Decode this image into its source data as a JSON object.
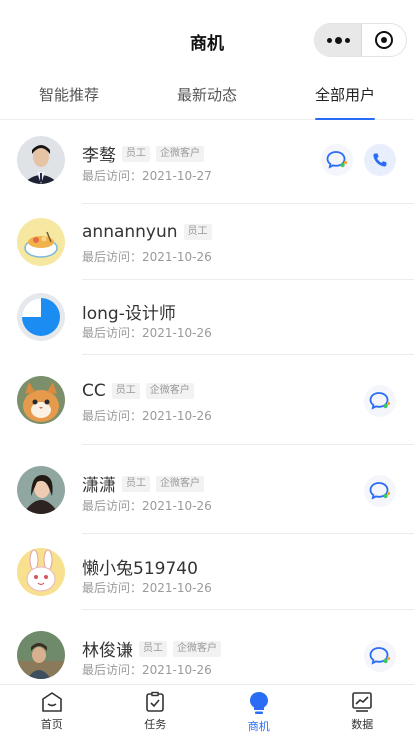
{
  "navbar": {
    "title": "商机"
  },
  "tabs": [
    {
      "label": "智能推荐",
      "active": false
    },
    {
      "label": "最新动态",
      "active": false
    },
    {
      "label": "全部用户",
      "active": true
    }
  ],
  "users": [
    {
      "name": "李骜",
      "tags": [
        "员工",
        "企微客户"
      ],
      "visit": "最后访问：2021-10-27",
      "avatar": "photo-man-suit",
      "chat": true,
      "phone": true
    },
    {
      "name": "annannyun",
      "tags": [
        "员工"
      ],
      "visit": "最后访问：2021-10-26",
      "avatar": "food-bowl",
      "chat": false,
      "phone": false
    },
    {
      "name": "long-设计师",
      "tags": [],
      "visit": "最后访问：2021-10-26",
      "avatar": "blue-pie",
      "chat": false,
      "phone": false
    },
    {
      "name": "CC",
      "tags": [
        "员工",
        "企微客户"
      ],
      "visit": "最后访问：2021-10-26",
      "avatar": "cat-photo",
      "chat": true,
      "phone": false
    },
    {
      "name": "潇潇",
      "tags": [
        "员工",
        "企微客户"
      ],
      "visit": "最后访问：2021-10-26",
      "avatar": "woman-photo",
      "chat": true,
      "phone": false
    },
    {
      "name": "懒小兔519740",
      "tags": [],
      "visit": "最后访问：2021-10-26",
      "avatar": "rabbit-cartoon",
      "chat": false,
      "phone": false
    },
    {
      "name": "林俊谦",
      "tags": [
        "员工",
        "企微客户"
      ],
      "visit": "最后访问：2021-10-26",
      "avatar": "outdoor-photo",
      "chat": true,
      "phone": false
    }
  ],
  "tabbar": [
    {
      "label": "首页",
      "icon": "home-icon",
      "active": false
    },
    {
      "label": "任务",
      "icon": "task-icon",
      "active": false
    },
    {
      "label": "商机",
      "icon": "bulb-icon",
      "active": true
    },
    {
      "label": "数据",
      "icon": "chart-icon",
      "active": false
    }
  ],
  "colors": {
    "accent": "#2a6df4",
    "chat_green": "#3cc46b",
    "chat_blue": "#2a6df4"
  }
}
